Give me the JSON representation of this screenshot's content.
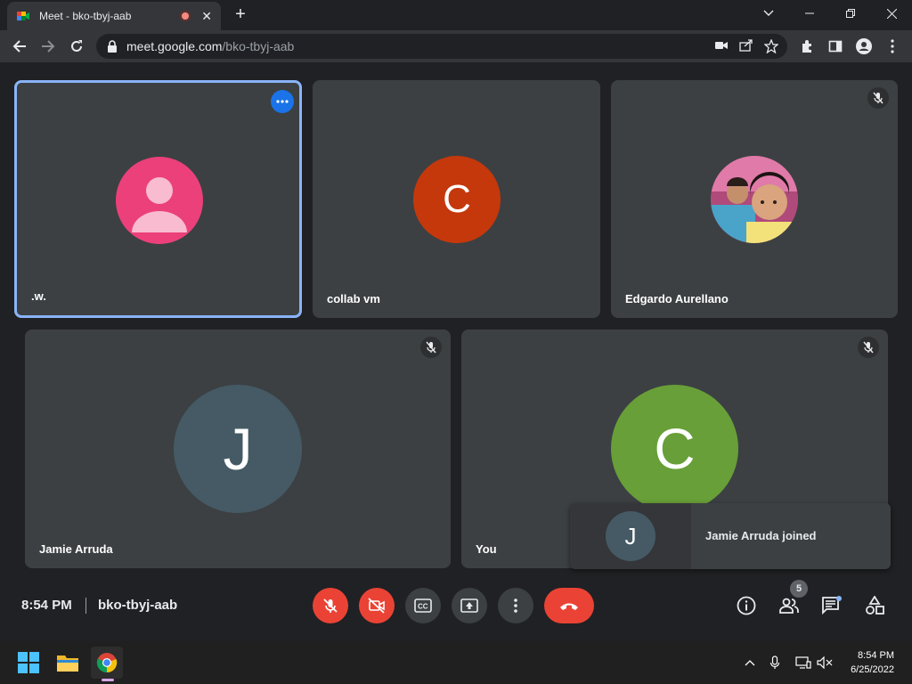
{
  "browser": {
    "tab_title": "Meet - bko-tbyj-aab",
    "url_host": "meet.google.com",
    "url_path": "/bko-tbyj-aab"
  },
  "participants": {
    "p1": {
      "name": ".w."
    },
    "p2": {
      "name": "collab vm",
      "initial": "C"
    },
    "p3": {
      "name": "Edgardo Aurellano"
    },
    "p4": {
      "name": "Jamie Arruda",
      "initial": "J"
    },
    "p5": {
      "name": "You",
      "initial": "C"
    }
  },
  "toast": {
    "initial": "J",
    "message": "Jamie Arruda joined"
  },
  "bottombar": {
    "time": "8:54 PM",
    "meeting_code": "bko-tbyj-aab",
    "people_count": "5"
  },
  "taskbar": {
    "time": "8:54 PM",
    "date": "6/25/2022"
  },
  "colors": {
    "accent_blue": "#8ab4f8",
    "danger_red": "#ea4335",
    "avatar_pink": "#ec407a",
    "avatar_orange": "#c5380b",
    "avatar_slate": "#455a64",
    "avatar_green": "#689f38"
  }
}
